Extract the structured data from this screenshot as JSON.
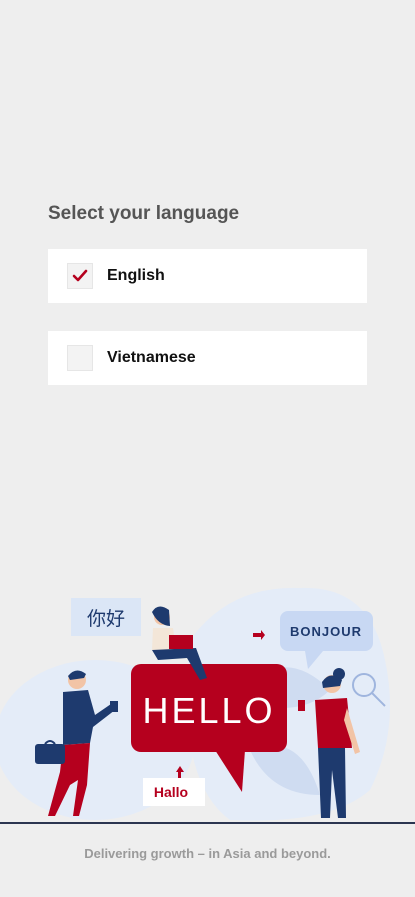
{
  "page": {
    "title": "Select your language",
    "footer": "Delivering growth – in Asia and beyond."
  },
  "languages": [
    {
      "label": "English",
      "checked": true
    },
    {
      "label": "Vietnamese",
      "checked": false
    }
  ],
  "illustration": {
    "bubble_chinese": "你好",
    "bubble_main": "HELLO",
    "bubble_german": "Hallo",
    "bubble_french": "BONJOUR"
  },
  "colors": {
    "accent": "#b5001e",
    "navy": "#1e3a6e",
    "light_blue": "#dbe6f6",
    "background": "#eeeeee"
  },
  "icons": {
    "checked": "check-icon"
  }
}
